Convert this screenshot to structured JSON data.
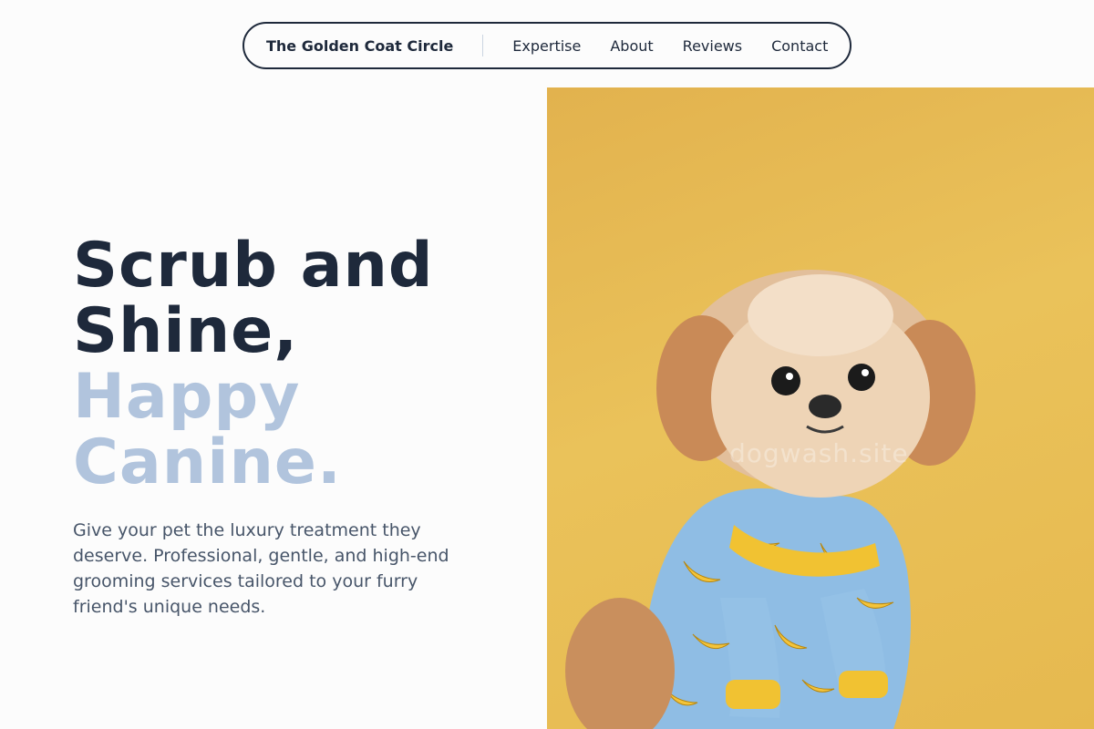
{
  "nav": {
    "brand": "The Golden Coat Circle",
    "links": [
      "Expertise",
      "About",
      "Reviews",
      "Contact"
    ]
  },
  "hero": {
    "title_dark": [
      "Scrub and",
      "Shine,"
    ],
    "title_light": [
      "Happy",
      "Canine."
    ],
    "description": "Give your pet the luxury treatment they deserve. Professional, gentle, and high-end grooming services tailored to your furry friend's unique needs.",
    "image": {
      "subject": "dog-in-banana-pajamas",
      "watermark": "dogwash.site",
      "background_color": "#e6b94f"
    }
  },
  "colors": {
    "dark_text": "#1e293b",
    "light_accent": "#b1c4dd",
    "body_text": "#475569"
  }
}
